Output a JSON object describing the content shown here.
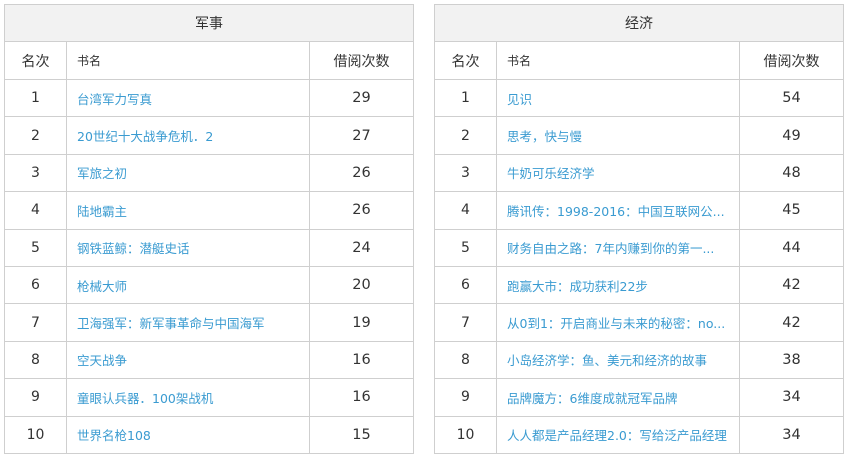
{
  "tables": [
    {
      "title": "军事",
      "headers": {
        "rank": "名次",
        "name": "书名",
        "count": "借阅次数"
      },
      "rows": [
        {
          "rank": "1",
          "name": "台湾军力写真",
          "count": "29"
        },
        {
          "rank": "2",
          "name": "20世纪十大战争危机．2",
          "count": "27"
        },
        {
          "rank": "3",
          "name": "军旅之初",
          "count": "26"
        },
        {
          "rank": "4",
          "name": "陆地霸主",
          "count": "26"
        },
        {
          "rank": "5",
          "name": "钢铁蓝鲸：潜艇史话",
          "count": "24"
        },
        {
          "rank": "6",
          "name": "枪械大师",
          "count": "20"
        },
        {
          "rank": "7",
          "name": "卫海强军：新军事革命与中国海军",
          "count": "19"
        },
        {
          "rank": "8",
          "name": "空天战争",
          "count": "16"
        },
        {
          "rank": "9",
          "name": "童眼认兵器．100架战机",
          "count": "16"
        },
        {
          "rank": "10",
          "name": "世界名枪108",
          "count": "15"
        }
      ]
    },
    {
      "title": "经济",
      "headers": {
        "rank": "名次",
        "name": "书名",
        "count": "借阅次数"
      },
      "rows": [
        {
          "rank": "1",
          "name": "见识",
          "count": "54"
        },
        {
          "rank": "2",
          "name": "思考，快与慢",
          "count": "49"
        },
        {
          "rank": "3",
          "name": "牛奶可乐经济学",
          "count": "48"
        },
        {
          "rank": "4",
          "name": "腾讯传：1998-2016：中国互联网公...",
          "count": "45"
        },
        {
          "rank": "5",
          "name": "财务自由之路：7年内赚到你的第一...",
          "count": "44"
        },
        {
          "rank": "6",
          "name": "跑赢大市：成功获利22步",
          "count": "42"
        },
        {
          "rank": "7",
          "name": "从0到1：开启商业与未来的秘密：no...",
          "count": "42"
        },
        {
          "rank": "8",
          "name": "小岛经济学：鱼、美元和经济的故事",
          "count": "38"
        },
        {
          "rank": "9",
          "name": "品牌魔方：6维度成就冠军品牌",
          "count": "34"
        },
        {
          "rank": "10",
          "name": "人人都是产品经理2.0：写给泛产品经理",
          "count": "34"
        }
      ]
    }
  ],
  "colors": {
    "link": "#3a9bd1",
    "border": "#cfcfcf",
    "title_bg": "#f2f2f2",
    "text": "#333333"
  }
}
